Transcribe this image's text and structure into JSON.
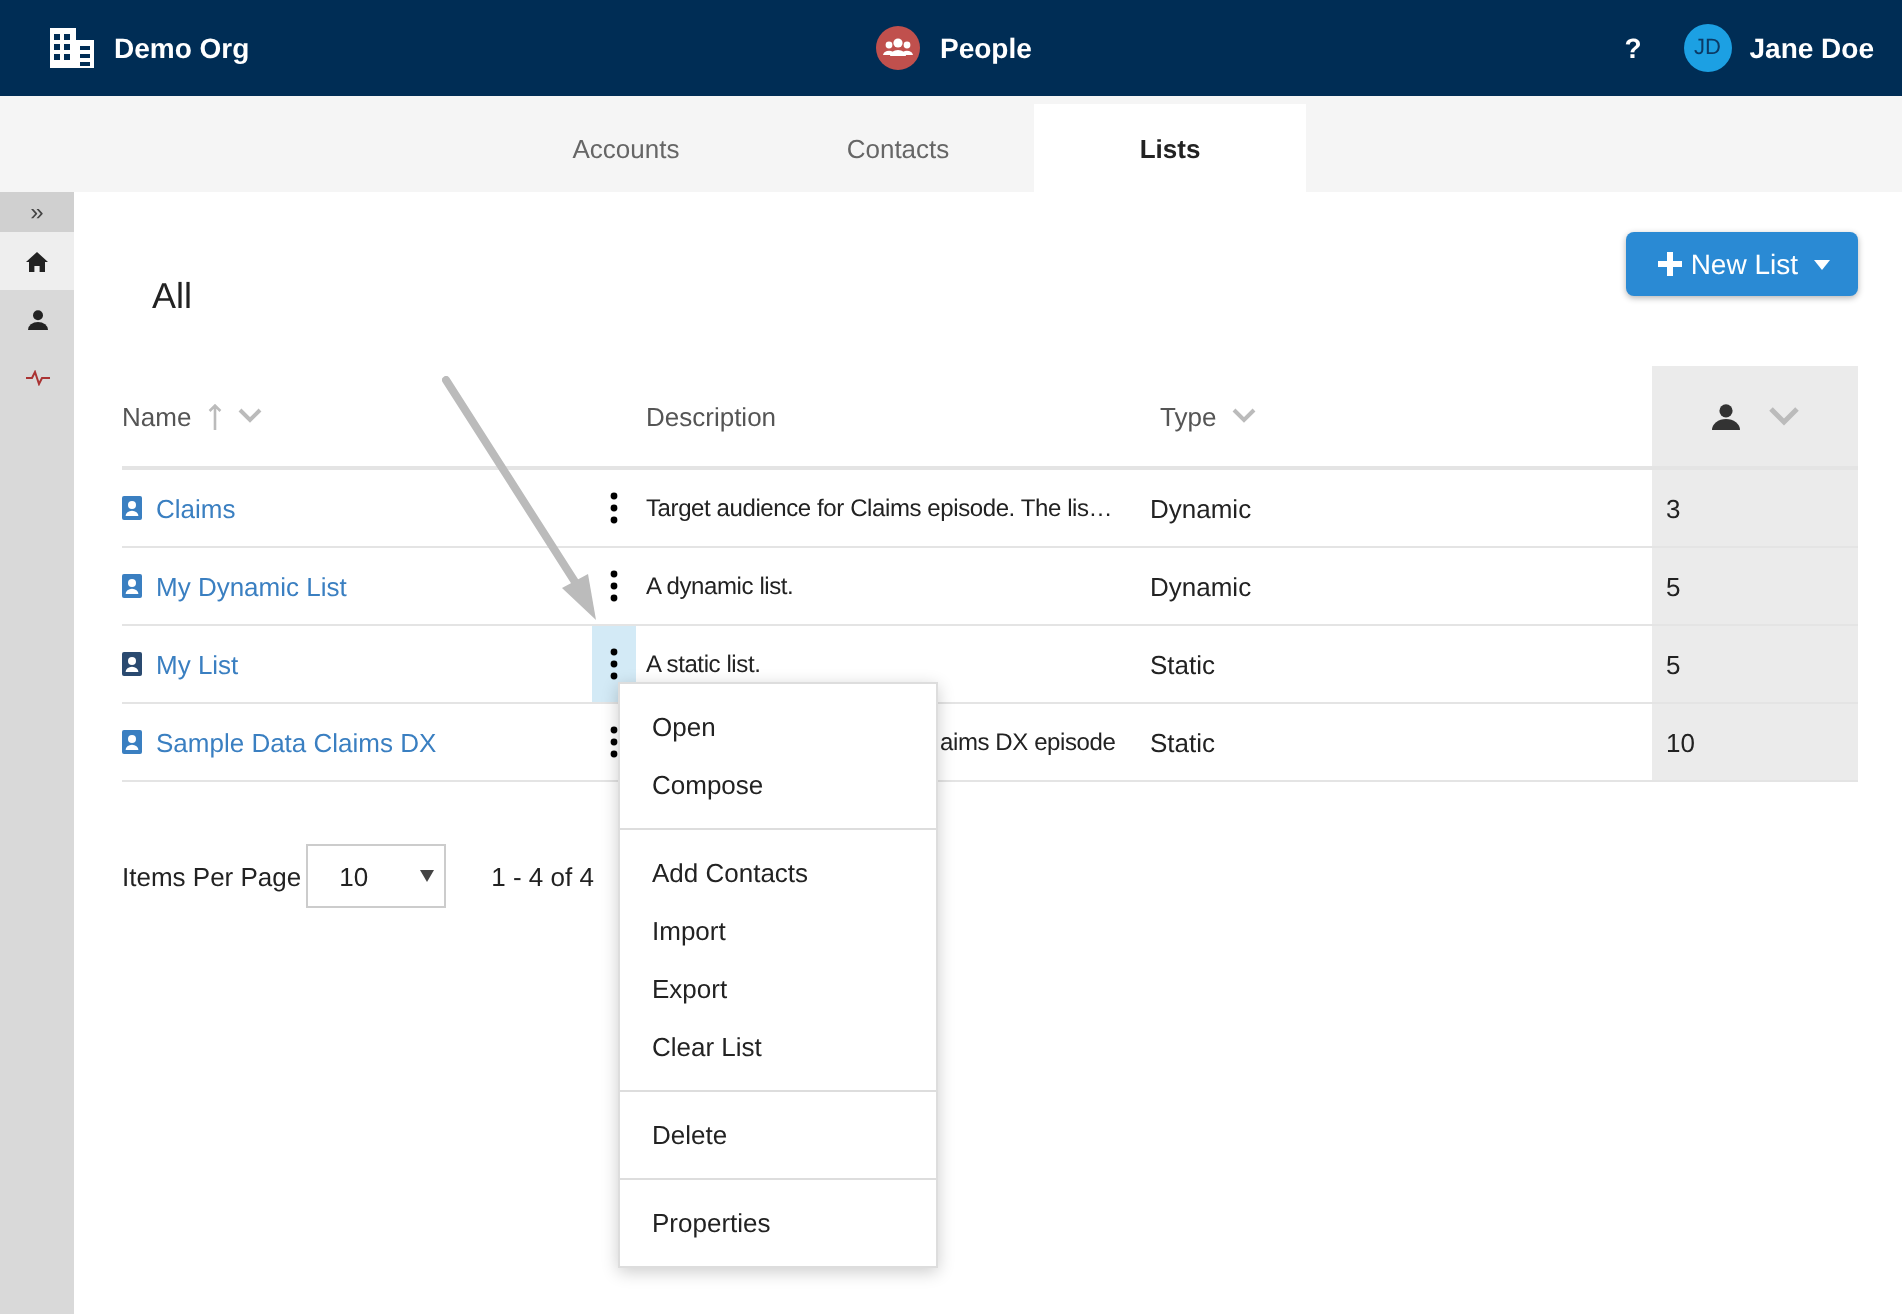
{
  "header": {
    "org": "Demo Org",
    "app": "People",
    "help": "?",
    "user": {
      "initials": "JD",
      "name": "Jane Doe"
    }
  },
  "tabs": [
    {
      "label": "Accounts",
      "selected": false
    },
    {
      "label": "Contacts",
      "selected": false
    },
    {
      "label": "Lists",
      "selected": true
    }
  ],
  "sidebar": {
    "toggle": "»",
    "items": [
      {
        "kind": "home",
        "selected": true
      },
      {
        "kind": "person",
        "selected": false
      },
      {
        "kind": "activity",
        "selected": false
      }
    ]
  },
  "page": {
    "title": "All",
    "new_button": "New List"
  },
  "table": {
    "columns": [
      {
        "label": "Name",
        "sorted": true
      },
      {
        "label": "Description",
        "sorted": false
      },
      {
        "label": "Type",
        "sorted": false
      }
    ],
    "rows": [
      {
        "name": "Claims",
        "description": "Target audience for Claims episode. The lis…",
        "type": "Dynamic",
        "count": "3",
        "selected": false,
        "partly_hidden": false
      },
      {
        "name": "My Dynamic List",
        "description": "A dynamic list.",
        "type": "Dynamic",
        "count": "5",
        "selected": false,
        "partly_hidden": false
      },
      {
        "name": "My List",
        "description": "A static list.",
        "type": "Static",
        "count": "5",
        "selected": true,
        "partly_hidden": false
      },
      {
        "name": "Sample Data Claims DX",
        "description": "aims DX episode",
        "type": "Static",
        "count": "10",
        "selected": false,
        "partly_hidden": true
      }
    ]
  },
  "pagination": {
    "label": "Items Per Page",
    "per_page": "10",
    "range": "1 - 4 of 4"
  },
  "menu": {
    "groups": [
      {
        "items": [
          "Open",
          "Compose"
        ]
      },
      {
        "items": [
          "Add Contacts",
          "Import",
          "Export",
          "Clear List"
        ]
      },
      {
        "items": [
          "Delete"
        ]
      },
      {
        "items": [
          "Properties"
        ]
      }
    ]
  }
}
